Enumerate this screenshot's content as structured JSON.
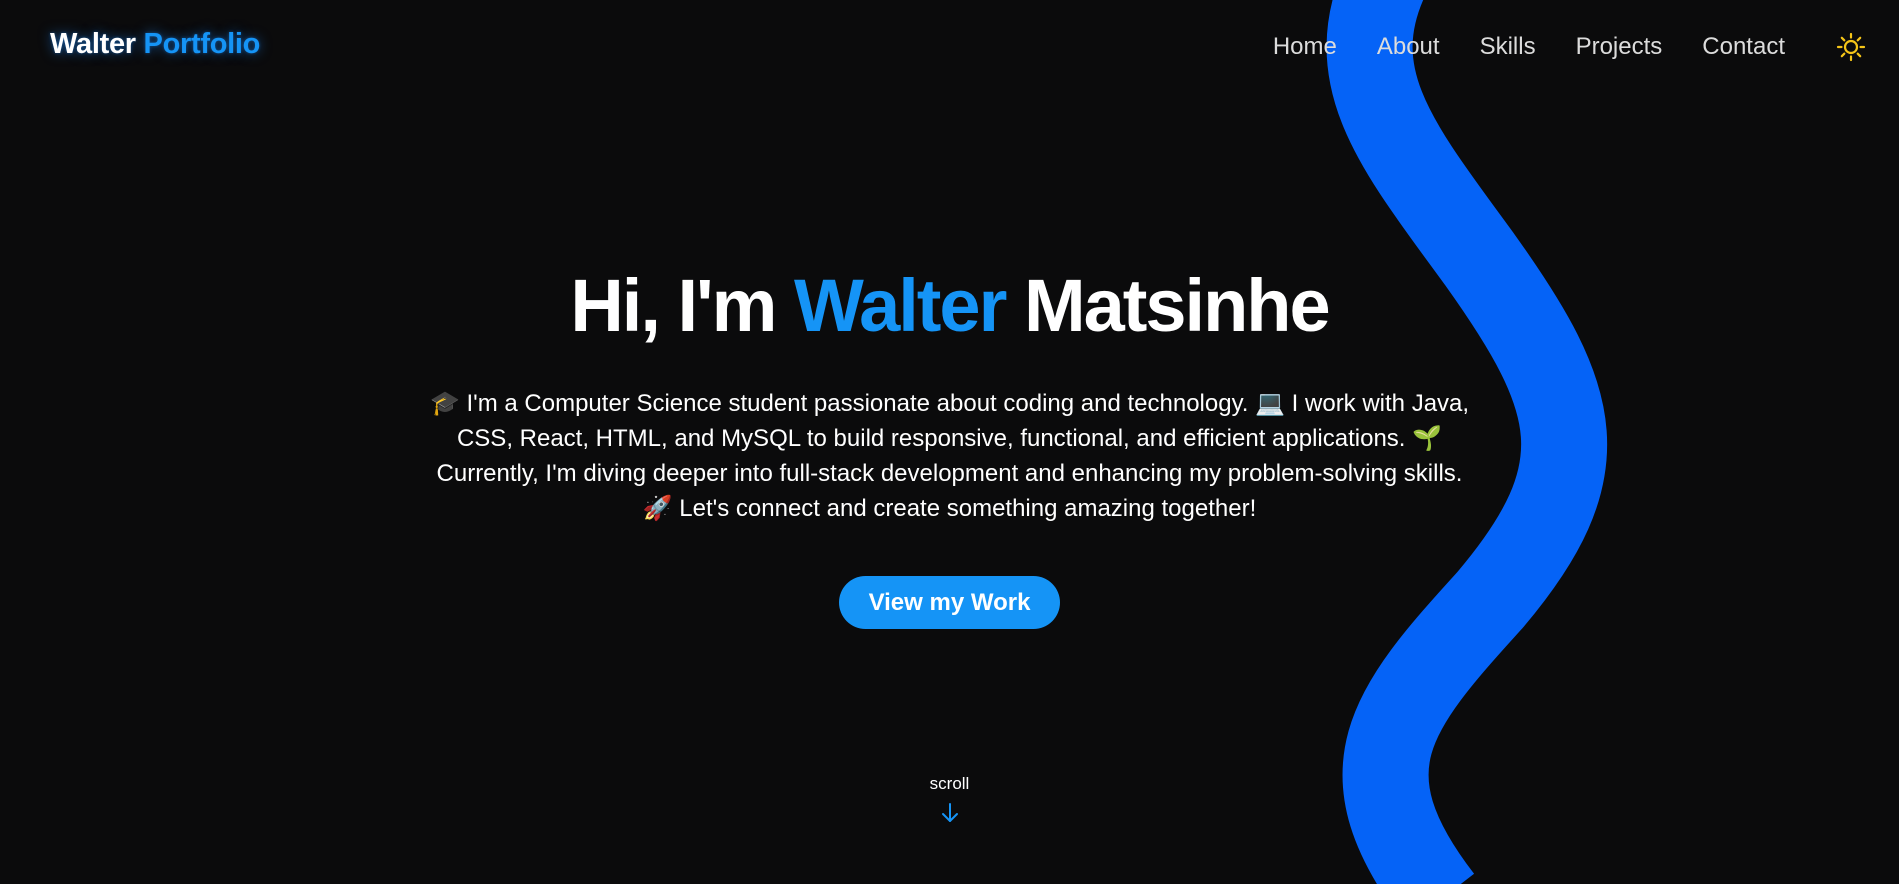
{
  "brand": {
    "name": "Walter",
    "suffix": "Portfolio"
  },
  "nav": {
    "items": [
      {
        "label": "Home"
      },
      {
        "label": "About"
      },
      {
        "label": "Skills"
      },
      {
        "label": "Projects"
      },
      {
        "label": "Contact"
      }
    ],
    "theme_toggle_icon": "sun-icon"
  },
  "hero": {
    "greeting": "Hi, I'm",
    "first_name": "Walter",
    "last_name": "Matsinhe",
    "bio": "🎓 I'm a Computer Science student passionate about coding and technology. 💻 I work with Java, CSS, React, HTML, and MySQL to build responsive, functional, and efficient applications. 🌱 Currently, I'm diving deeper into full-stack development and enhancing my problem-solving skills. 🚀 Let's connect and create something amazing together!",
    "cta_label": "View my Work"
  },
  "scroll": {
    "label": "scroll",
    "icon": "arrow-down-icon"
  },
  "colors": {
    "background": "#0b0b0c",
    "accent": "#1594f6",
    "wave": "#0563f7",
    "sun": "#f5c518"
  }
}
